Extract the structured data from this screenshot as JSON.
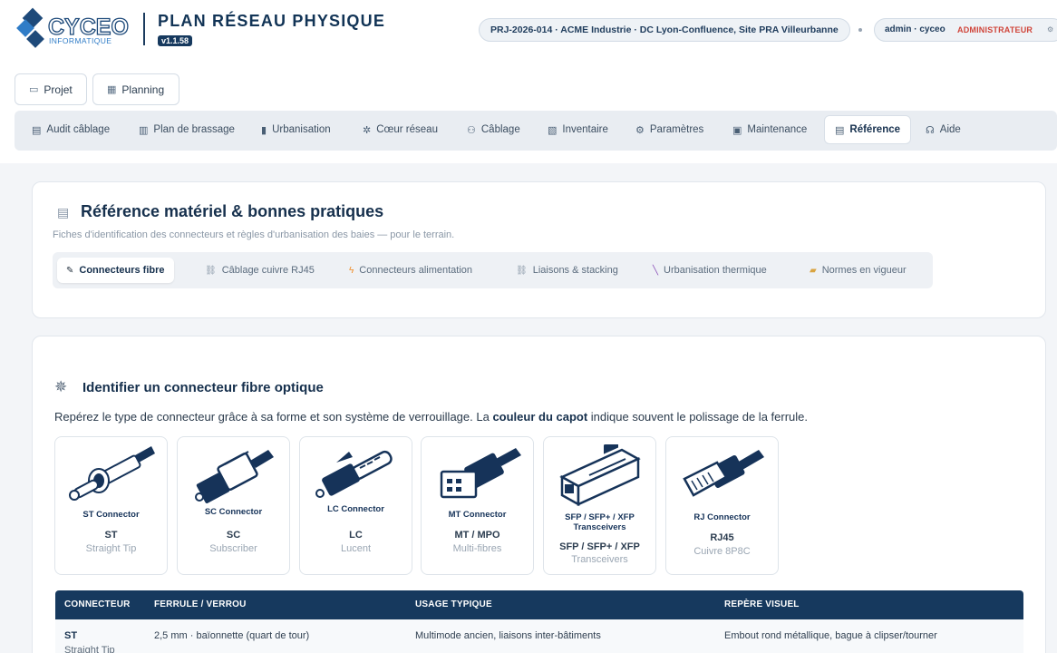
{
  "brand": {
    "name": "CYCEO",
    "tagline": "INFORMATIQUE",
    "app_title": "PLAN RÉSEAU PHYSIQUE",
    "version": "v1.1.58"
  },
  "project": "PRJ-2026-014 · ACME Industrie · DC Lyon-Confluence, Site PRA Villeurbanne",
  "user": {
    "name": "admin · cyceo",
    "role": "ADMINISTRATEUR"
  },
  "buttons": {
    "projet": "Projet",
    "planning": "Planning"
  },
  "tabs": [
    "Audit câblage",
    "Plan de brassage",
    "Urbanisation",
    "Cœur réseau",
    "Câblage",
    "Inventaire",
    "Paramètres",
    "Maintenance",
    "Référence",
    "Aide"
  ],
  "reference": {
    "title": "Référence matériel & bonnes pratiques",
    "subtitle": "Fiches d'identification des connecteurs et règles d'urbanisation des baies — pour le terrain.",
    "subtabs": [
      "Connecteurs fibre",
      "Câblage cuivre RJ45",
      "Connecteurs alimentation",
      "Liaisons & stacking",
      "Urbanisation thermique",
      "Normes en vigueur"
    ]
  },
  "fiber": {
    "title": "Identifier un connecteur fibre optique",
    "desc_pre": "Repérez le type de connecteur grâce à sa forme et son système de verrouillage. La ",
    "desc_bold": "couleur du capot",
    "desc_post": " indique souvent le polissage de la ferrule.",
    "connectors": [
      {
        "label": "ST Connector",
        "name": "ST",
        "desc": "Straight Tip"
      },
      {
        "label": "SC Connector",
        "name": "SC",
        "desc": "Subscriber"
      },
      {
        "label": "LC Connector",
        "name": "LC",
        "desc": "Lucent"
      },
      {
        "label": "MT Connector",
        "name": "MT / MPO",
        "desc": "Multi-fibres"
      },
      {
        "label": "SFP / SFP+ / XFP Transceivers",
        "name": "SFP / SFP+ / XFP",
        "desc": "Transceivers"
      },
      {
        "label": "RJ Connector",
        "name": "RJ45",
        "desc": "Cuivre 8P8C"
      }
    ],
    "table": {
      "headers": [
        "CONNECTEUR",
        "FERRULE / VERROU",
        "USAGE TYPIQUE",
        "REPÈRE VISUEL"
      ],
      "rows": [
        {
          "name": "ST",
          "sub": "Straight Tip",
          "ferrule": "2,5 mm · baïonnette (quart de tour)",
          "usage": "Multimode ancien, liaisons inter-bâtiments",
          "visual": "Embout rond métallique, bague à clipser/tourner"
        }
      ]
    }
  }
}
